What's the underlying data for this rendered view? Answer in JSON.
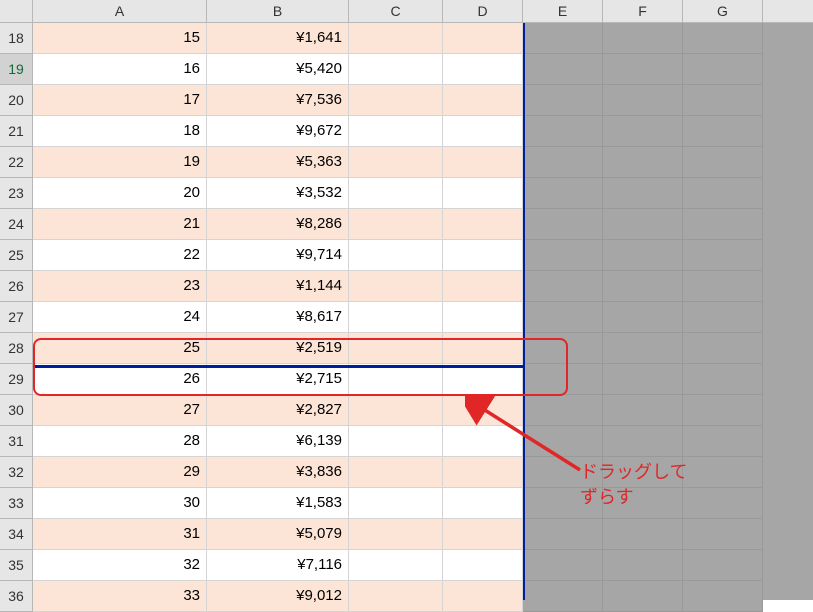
{
  "columns": [
    {
      "label": "A",
      "cls": "cA"
    },
    {
      "label": "B",
      "cls": "cB"
    },
    {
      "label": "C",
      "cls": "cC"
    },
    {
      "label": "D",
      "cls": "cD"
    },
    {
      "label": "E",
      "cls": "cE",
      "outside": true
    },
    {
      "label": "F",
      "cls": "cF",
      "outside": true
    },
    {
      "label": "G",
      "cls": "cG",
      "outside": true
    }
  ],
  "rows": [
    {
      "n": 18,
      "a": "15",
      "b": "¥1,641",
      "band": true
    },
    {
      "n": 19,
      "a": "16",
      "b": "¥5,420",
      "band": false,
      "active": true
    },
    {
      "n": 20,
      "a": "17",
      "b": "¥7,536",
      "band": true
    },
    {
      "n": 21,
      "a": "18",
      "b": "¥9,672",
      "band": false
    },
    {
      "n": 22,
      "a": "19",
      "b": "¥5,363",
      "band": true
    },
    {
      "n": 23,
      "a": "20",
      "b": "¥3,532",
      "band": false
    },
    {
      "n": 24,
      "a": "21",
      "b": "¥8,286",
      "band": true
    },
    {
      "n": 25,
      "a": "22",
      "b": "¥9,714",
      "band": false
    },
    {
      "n": 26,
      "a": "23",
      "b": "¥1,144",
      "band": true
    },
    {
      "n": 27,
      "a": "24",
      "b": "¥8,617",
      "band": false
    },
    {
      "n": 28,
      "a": "25",
      "b": "¥2,519",
      "band": true
    },
    {
      "n": 29,
      "a": "26",
      "b": "¥2,715",
      "band": false
    },
    {
      "n": 30,
      "a": "27",
      "b": "¥2,827",
      "band": true
    },
    {
      "n": 31,
      "a": "28",
      "b": "¥6,139",
      "band": false
    },
    {
      "n": 32,
      "a": "29",
      "b": "¥3,836",
      "band": true
    },
    {
      "n": 33,
      "a": "30",
      "b": "¥1,583",
      "band": false
    },
    {
      "n": 34,
      "a": "31",
      "b": "¥5,079",
      "band": true
    },
    {
      "n": 35,
      "a": "32",
      "b": "¥7,116",
      "band": false
    },
    {
      "n": 36,
      "a": "33",
      "b": "¥9,012",
      "band": true
    }
  ],
  "annotation": {
    "line1": "ドラッグして",
    "line2": "ずらす"
  },
  "chart_data": {
    "type": "table",
    "columns": [
      "A",
      "B"
    ],
    "data": [
      [
        15,
        1641
      ],
      [
        16,
        5420
      ],
      [
        17,
        7536
      ],
      [
        18,
        9672
      ],
      [
        19,
        5363
      ],
      [
        20,
        3532
      ],
      [
        21,
        8286
      ],
      [
        22,
        9714
      ],
      [
        23,
        1144
      ],
      [
        24,
        8617
      ],
      [
        25,
        2519
      ],
      [
        26,
        2715
      ],
      [
        27,
        2827
      ],
      [
        28,
        6139
      ],
      [
        29,
        3836
      ],
      [
        30,
        1583
      ],
      [
        31,
        5079
      ],
      [
        32,
        7116
      ],
      [
        33,
        9012
      ]
    ],
    "currency": "JPY"
  }
}
